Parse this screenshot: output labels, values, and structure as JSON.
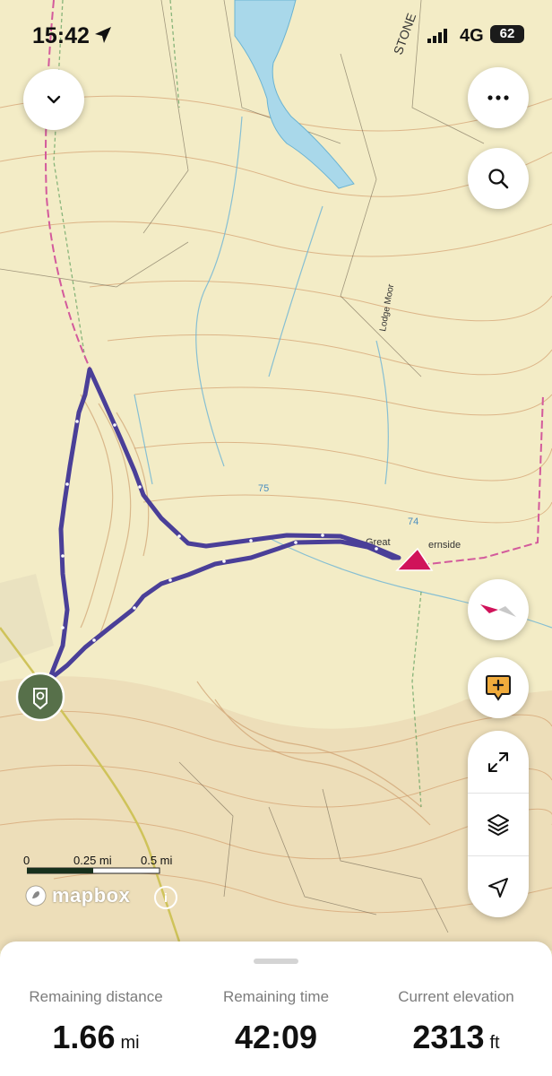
{
  "status_bar": {
    "time": "15:42",
    "network": "4G",
    "battery": "62"
  },
  "map": {
    "labels": [
      "STONE",
      "Great",
      "ernside",
      "Lodge Moor",
      "75",
      "74"
    ],
    "scale": {
      "ticks": [
        "0",
        "0.25 mi",
        "0.5 mi"
      ]
    },
    "attribution": {
      "brand": "mapbox",
      "info": "i"
    }
  },
  "controls": {
    "collapse": "chevron-down-icon",
    "more": "more-icon",
    "search": "search-icon",
    "compass": "compass-icon",
    "add_note": "add-note-icon",
    "expand": "expand-icon",
    "layers": "layers-icon",
    "locate": "navigation-arrow-icon"
  },
  "stats": {
    "distance": {
      "label": "Remaining distance",
      "value": "1.66",
      "unit": "mi"
    },
    "time": {
      "label": "Remaining time",
      "value": "42:09",
      "unit": ""
    },
    "elevation": {
      "label": "Current elevation",
      "value": "2313",
      "unit": "ft"
    }
  },
  "colors": {
    "route": "#4a3f98",
    "marker": "#d0135a",
    "start": "#57704a",
    "map_bg": "#f3ecc6",
    "water": "#a9d8ea"
  }
}
